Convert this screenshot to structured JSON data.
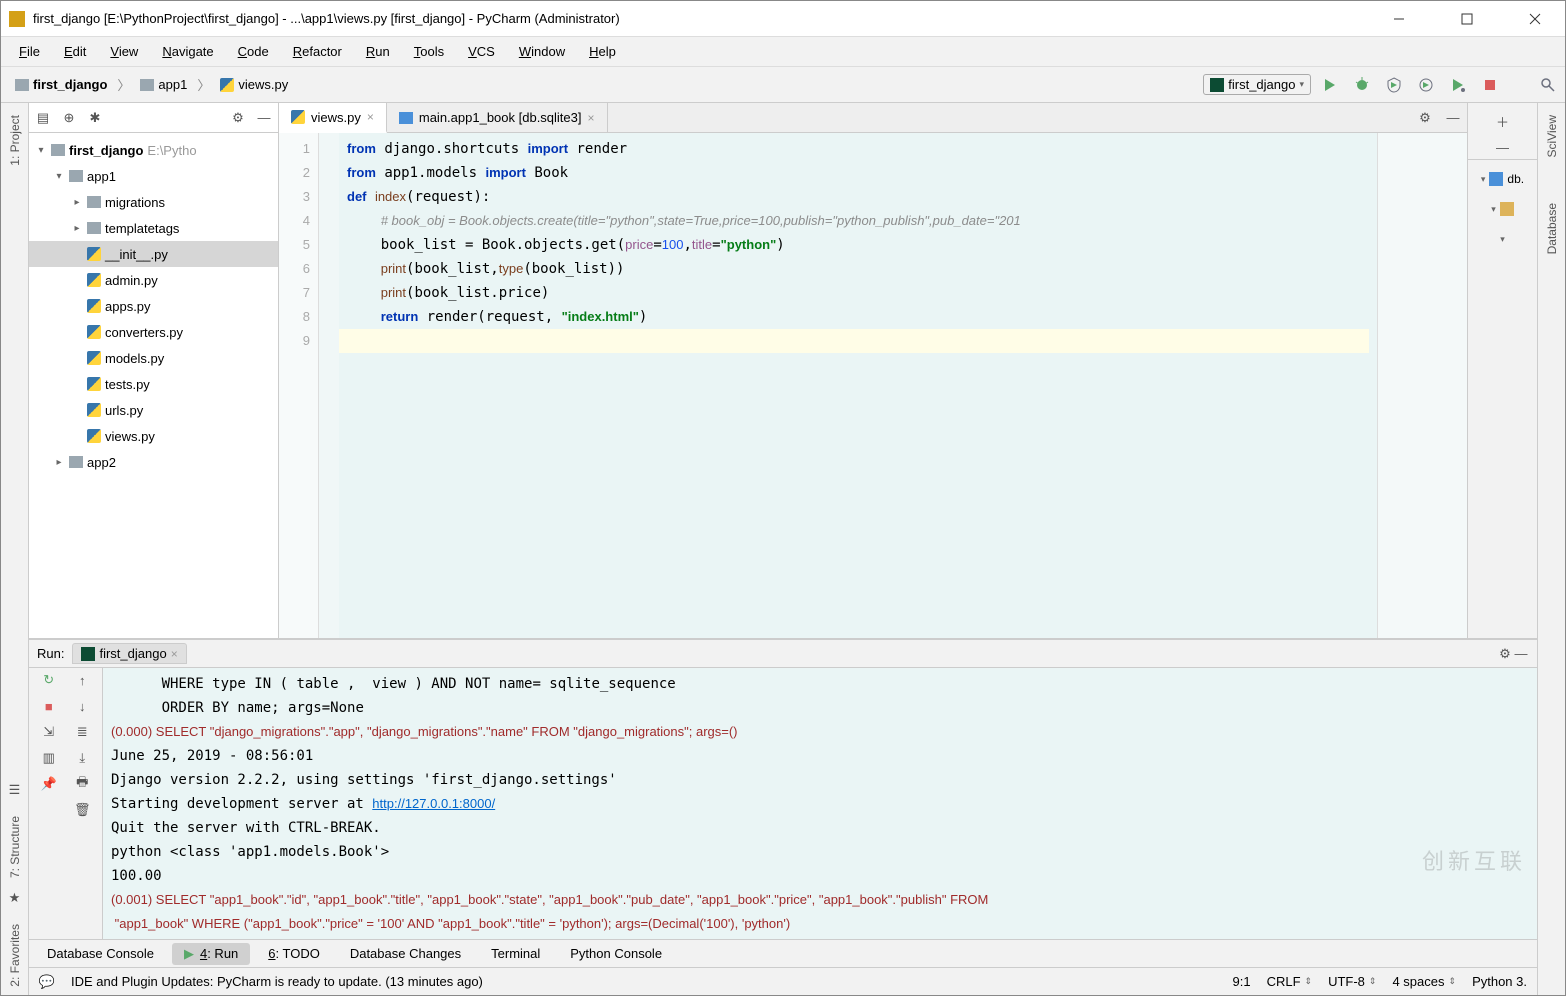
{
  "window": {
    "title": "first_django [E:\\PythonProject\\first_django] - ...\\app1\\views.py [first_django] - PyCharm (Administrator)"
  },
  "menu": [
    "File",
    "Edit",
    "View",
    "Navigate",
    "Code",
    "Refactor",
    "Run",
    "Tools",
    "VCS",
    "Window",
    "Help"
  ],
  "breadcrumb": [
    {
      "icon": "folder",
      "label": "first_django"
    },
    {
      "icon": "folder",
      "label": "app1"
    },
    {
      "icon": "py",
      "label": "views.py"
    }
  ],
  "run_config": {
    "name": "first_django"
  },
  "gutters": {
    "left": [
      "1: Project"
    ],
    "right_top": [
      "SciView"
    ],
    "right_bottom": [
      "Database"
    ],
    "extra": [
      "7: Structure",
      "2: Favorites"
    ]
  },
  "project": {
    "root_label": "first_django",
    "root_path": "E:\\Pytho",
    "tree": [
      {
        "depth": 0,
        "chev": "▾",
        "icon": "folder",
        "label": "first_django",
        "bold": true,
        "path": "E:\\Pytho"
      },
      {
        "depth": 1,
        "chev": "▾",
        "icon": "folder",
        "label": "app1"
      },
      {
        "depth": 2,
        "chev": "▸",
        "icon": "folder",
        "label": "migrations"
      },
      {
        "depth": 2,
        "chev": "▸",
        "icon": "folder",
        "label": "templatetags"
      },
      {
        "depth": 2,
        "chev": "",
        "icon": "py",
        "label": "__init__.py",
        "selected": true
      },
      {
        "depth": 2,
        "chev": "",
        "icon": "py",
        "label": "admin.py"
      },
      {
        "depth": 2,
        "chev": "",
        "icon": "py",
        "label": "apps.py"
      },
      {
        "depth": 2,
        "chev": "",
        "icon": "py",
        "label": "converters.py"
      },
      {
        "depth": 2,
        "chev": "",
        "icon": "py",
        "label": "models.py"
      },
      {
        "depth": 2,
        "chev": "",
        "icon": "py",
        "label": "tests.py"
      },
      {
        "depth": 2,
        "chev": "",
        "icon": "py",
        "label": "urls.py"
      },
      {
        "depth": 2,
        "chev": "",
        "icon": "py",
        "label": "views.py"
      },
      {
        "depth": 1,
        "chev": "▸",
        "icon": "folder",
        "label": "app2"
      }
    ]
  },
  "editor_tabs": [
    {
      "icon": "py",
      "label": "views.py",
      "active": true,
      "closable": true
    },
    {
      "icon": "db",
      "label": "main.app1_book [db.sqlite3]",
      "active": false,
      "closable": true
    }
  ],
  "code": {
    "line_count": 9,
    "html": "<span class='kw'>from</span> django.shortcuts <span class='kw'>import</span> render\n<span class='kw'>from</span> app1.models <span class='kw'>import</span> Book\n<span class='kw'>def</span> <span class='fn'>index</span>(request):\n    <span class='cmt'># book_obj = Book.objects.create(title=\"python\",state=True,price=100,publish=\"python_publish\",pub_date=\"201</span>\n    book_list = Book.objects.get(<span class='self'>price</span>=<span class='num'>100</span>,<span class='self'>title</span>=<span class='str'>\"python\"</span>)\n    <span class='fn'>print</span>(book_list,<span class='fn'>type</span>(book_list))\n    <span class='fn'>print</span>(book_list.price)\n    <span class='kw'>return</span> render(request, <span class='str'>\"index.html\"</span>)\n<span class='caret-line'> </span>"
  },
  "run": {
    "label": "Run:",
    "tab": "first_django",
    "console_html": "      WHERE type IN ( table ,  view ) AND NOT name= sqlite_sequence \n      ORDER BY name; args=None\n<span class='q'>(0.000) SELECT \"django_migrations\".\"app\", \"django_migrations\".\"name\" FROM \"django_migrations\"; args=()</span>\nJune 25, 2019 - 08:56:01\nDjango version 2.2.2, using settings 'first_django.settings'\nStarting development server at <a href='#'>http://127.0.0.1:8000/</a>\nQuit the server with CTRL-BREAK.\npython &lt;class 'app1.models.Book'&gt;\n100.00\n<span class='q'>(0.001) SELECT \"app1_book\".\"id\", \"app1_book\".\"title\", \"app1_book\".\"state\", \"app1_book\".\"pub_date\", \"app1_book\".\"price\", \"app1_book\".\"publish\" FROM\n \"app1_book\" WHERE (\"app1_book\".\"price\" = '100' AND \"app1_book\".\"title\" = 'python'); args=(Decimal('100'), 'python')</span>"
  },
  "bottom_tabs": [
    {
      "label": "Database Console"
    },
    {
      "label": "4: Run",
      "active": true,
      "underline": "4"
    },
    {
      "label": "6: TODO",
      "underline": "6"
    },
    {
      "label": "Database Changes"
    },
    {
      "label": "Terminal"
    },
    {
      "label": "Python Console"
    }
  ],
  "status": {
    "msg": "IDE and Plugin Updates: PyCharm is ready to update. (13 minutes ago)",
    "lncol": "9:1",
    "eol": "CRLF",
    "enc": "UTF-8",
    "indent": "4 spaces",
    "interp": "Python 3."
  },
  "right_panel": {
    "items": [
      "db."
    ]
  },
  "watermark": "创新互联"
}
